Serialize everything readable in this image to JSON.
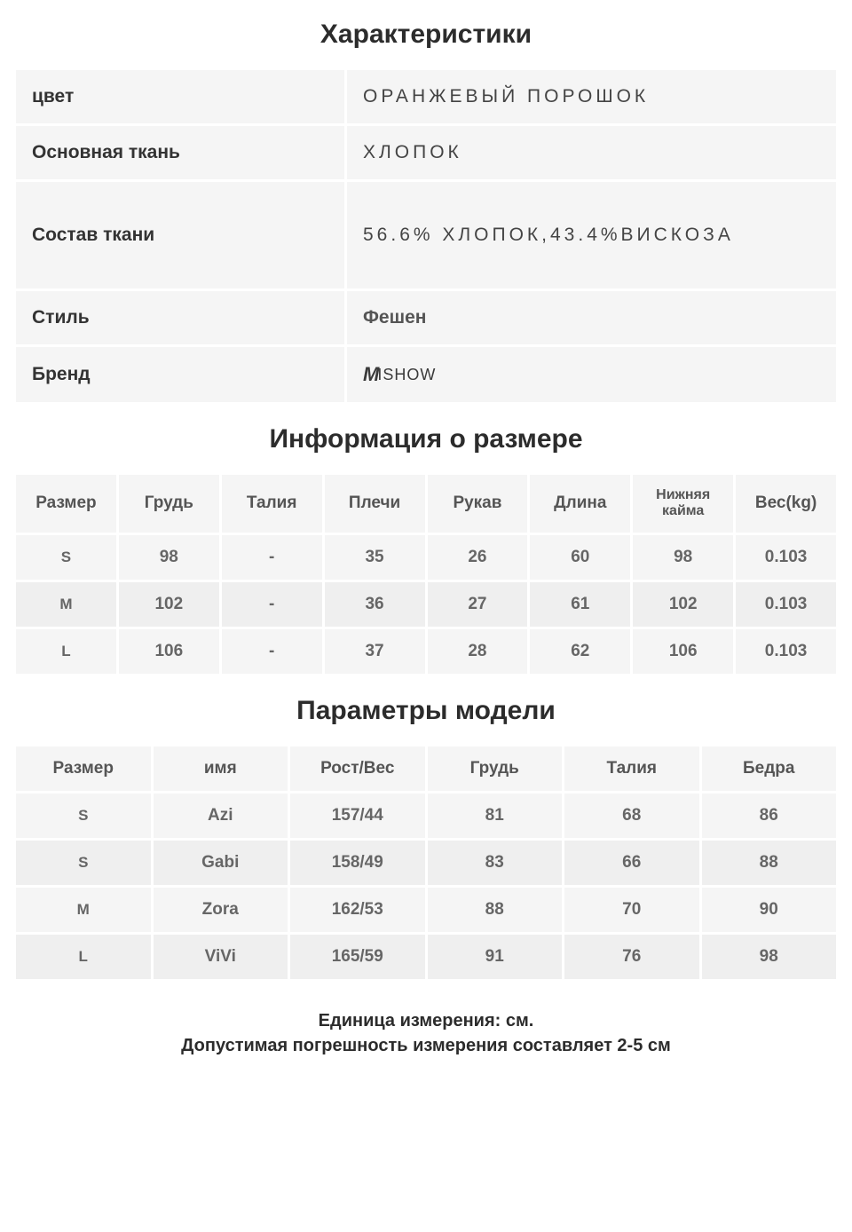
{
  "chart_data": [
    {
      "type": "table",
      "title": "Характеристики",
      "rows": [
        {
          "label": "цвет",
          "value": "ОРАНЖЕВЫЙ ПОРОШОК"
        },
        {
          "label": "Основная ткань",
          "value": "ХЛОПОК"
        },
        {
          "label": "Состав ткани",
          "value": "56.6% ХЛОПОК,43.4%ВИСКОЗА"
        },
        {
          "label": "Стиль",
          "value": "Фешен"
        },
        {
          "label": "Бренд",
          "value": "MISHOW"
        }
      ]
    },
    {
      "type": "table",
      "title": "Информация о размере",
      "headers": [
        "Размер",
        "Грудь",
        "Талия",
        "Плечи",
        "Рукав",
        "Длина",
        "Нижняя кайма",
        "Вес(kg)"
      ],
      "rows": [
        {
          "size": "S",
          "bust": "98",
          "waist": "-",
          "shoulders": "35",
          "sleeve": "26",
          "length": "60",
          "hem": "98",
          "weight": "0.103"
        },
        {
          "size": "M",
          "bust": "102",
          "waist": "-",
          "shoulders": "36",
          "sleeve": "27",
          "length": "61",
          "hem": "102",
          "weight": "0.103"
        },
        {
          "size": "L",
          "bust": "106",
          "waist": "-",
          "shoulders": "37",
          "sleeve": "28",
          "length": "62",
          "hem": "106",
          "weight": "0.103"
        }
      ]
    },
    {
      "type": "table",
      "title": "Параметры модели",
      "headers": [
        "Размер",
        "имя",
        "Рост/Вес",
        "Грудь",
        "Талия",
        "Бедра"
      ],
      "rows": [
        {
          "size": "S",
          "name": "Azi",
          "hw": "157/44",
          "bust": "81",
          "waist": "68",
          "hips": "86"
        },
        {
          "size": "S",
          "name": "Gabi",
          "hw": "158/49",
          "bust": "83",
          "waist": "66",
          "hips": "88"
        },
        {
          "size": "M",
          "name": "Zora",
          "hw": "162/53",
          "bust": "88",
          "waist": "70",
          "hips": "90"
        },
        {
          "size": "L",
          "name": "ViVi",
          "hw": "165/59",
          "bust": "91",
          "waist": "76",
          "hips": "98"
        }
      ]
    }
  ],
  "headings": {
    "characteristics": "Характеристики",
    "size_info": "Информация о размере",
    "model_params": "Параметры модели"
  },
  "characteristics": {
    "color_label": "цвет",
    "color_value": "ОРАНЖЕВЫЙ ПОРОШОК",
    "fabric_label": "Основная ткань",
    "fabric_value": "ХЛОПОК",
    "composition_label": "Состав ткани",
    "composition_value": "56.6% ХЛОПОК,43.4%ВИСКОЗА",
    "style_label": "Стиль",
    "style_value": "Фешен",
    "brand_label": "Бренд",
    "brand_value": "MISHOW"
  },
  "size_headers": {
    "size": "Размер",
    "bust": "Грудь",
    "waist": "Талия",
    "shoulders": "Плечи",
    "sleeve": "Рукав",
    "length": "Длина",
    "hem": "Нижняя кайма",
    "weight": "Вес(kg)"
  },
  "sizes": [
    {
      "size": "S",
      "bust": "98",
      "waist": "-",
      "shoulders": "35",
      "sleeve": "26",
      "length": "60",
      "hem": "98",
      "weight": "0.103"
    },
    {
      "size": "M",
      "bust": "102",
      "waist": "-",
      "shoulders": "36",
      "sleeve": "27",
      "length": "61",
      "hem": "102",
      "weight": "0.103"
    },
    {
      "size": "L",
      "bust": "106",
      "waist": "-",
      "shoulders": "37",
      "sleeve": "28",
      "length": "62",
      "hem": "106",
      "weight": "0.103"
    }
  ],
  "model_headers": {
    "size": "Размер",
    "name": "имя",
    "hw": "Рост/Вес",
    "bust": "Грудь",
    "waist": "Талия",
    "hips": "Бедра"
  },
  "models": [
    {
      "size": "S",
      "name": "Azi",
      "hw": "157/44",
      "bust": "81",
      "waist": "68",
      "hips": "86"
    },
    {
      "size": "S",
      "name": "Gabi",
      "hw": "158/49",
      "bust": "83",
      "waist": "66",
      "hips": "88"
    },
    {
      "size": "M",
      "name": "Zora",
      "hw": "162/53",
      "bust": "88",
      "waist": "70",
      "hips": "90"
    },
    {
      "size": "L",
      "name": "ViVi",
      "hw": "165/59",
      "bust": "91",
      "waist": "76",
      "hips": "98"
    }
  ],
  "footer": {
    "unit": "Единица измерения: см.",
    "tolerance": "Допустимая погрешность измерения составляет 2-5 см"
  }
}
